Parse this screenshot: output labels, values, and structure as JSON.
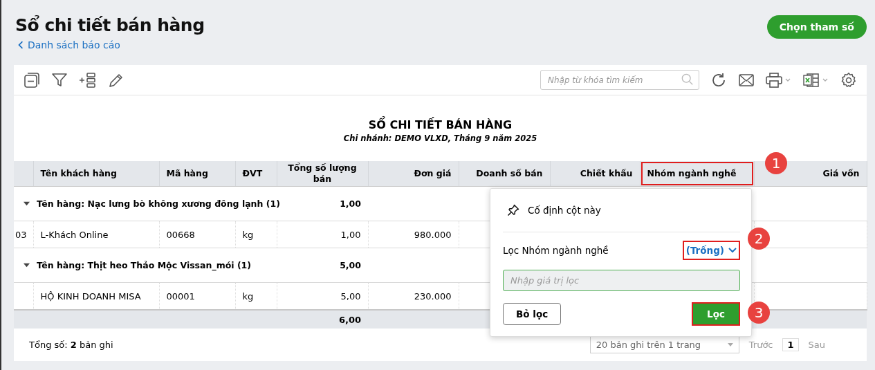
{
  "page": {
    "title": "Sổ chi tiết bán hàng",
    "back_link": "Danh sách báo cáo",
    "primary_button": "Chọn tham số"
  },
  "search": {
    "placeholder": "Nhập từ khóa tìm kiếm"
  },
  "report": {
    "title": "SỔ CHI TIẾT BÁN HÀNG",
    "subtitle": "Chi nhánh: DEMO VLXD, Tháng 9 năm 2025"
  },
  "table": {
    "columns": [
      {
        "label": "Tên khách hàng",
        "highlighted": false
      },
      {
        "label": "Mã hàng",
        "highlighted": false
      },
      {
        "label": "ĐVT",
        "highlighted": false
      },
      {
        "label": "Tổng số lượng bán",
        "highlighted": false
      },
      {
        "label": "Đơn giá",
        "highlighted": false
      },
      {
        "label": "Doanh số bán",
        "highlighted": false
      },
      {
        "label": "Chiết khấu",
        "highlighted": false
      },
      {
        "label": "Nhóm ngành nghề",
        "highlighted": true
      },
      {
        "label": "Giá vốn",
        "highlighted": false
      }
    ],
    "rows": [
      {
        "kind": "group",
        "expanded": true,
        "label": "Tên hàng: Nạc lưng bò không xương đông lạnh (1)",
        "quantity": "1,00"
      },
      {
        "kind": "item",
        "cells": [
          "03",
          "L-Khách Online",
          "00668",
          "kg",
          "1,00",
          "980.000"
        ]
      },
      {
        "kind": "group",
        "expanded": true,
        "label": "Tên hàng: Thịt heo Thảo Mộc Vissan_mói (1)",
        "quantity": "5,00"
      },
      {
        "kind": "item",
        "cells": [
          "",
          "HỘ KINH DOANH MISA",
          "00001",
          "kg",
          "5,00",
          "230.000"
        ]
      }
    ],
    "total": {
      "quantity": "6,00"
    }
  },
  "footer": {
    "total_label": "Tổng số: **2** bản ghi",
    "page_size": "20 bản ghi trên 1 trang",
    "prev": "Trước",
    "page": "1",
    "next": "Sau"
  },
  "popup": {
    "pin_label": "Cố định cột này",
    "filter_label": "Lọc Nhóm ngành nghề",
    "operator": "(Trống)",
    "operator_highlighted": true,
    "input_placeholder": "Nhập giá trị lọc",
    "clear_button": "Bỏ lọc",
    "apply_button": "Lọc",
    "apply_highlighted": true
  },
  "callouts": [
    "1",
    "2",
    "3"
  ]
}
